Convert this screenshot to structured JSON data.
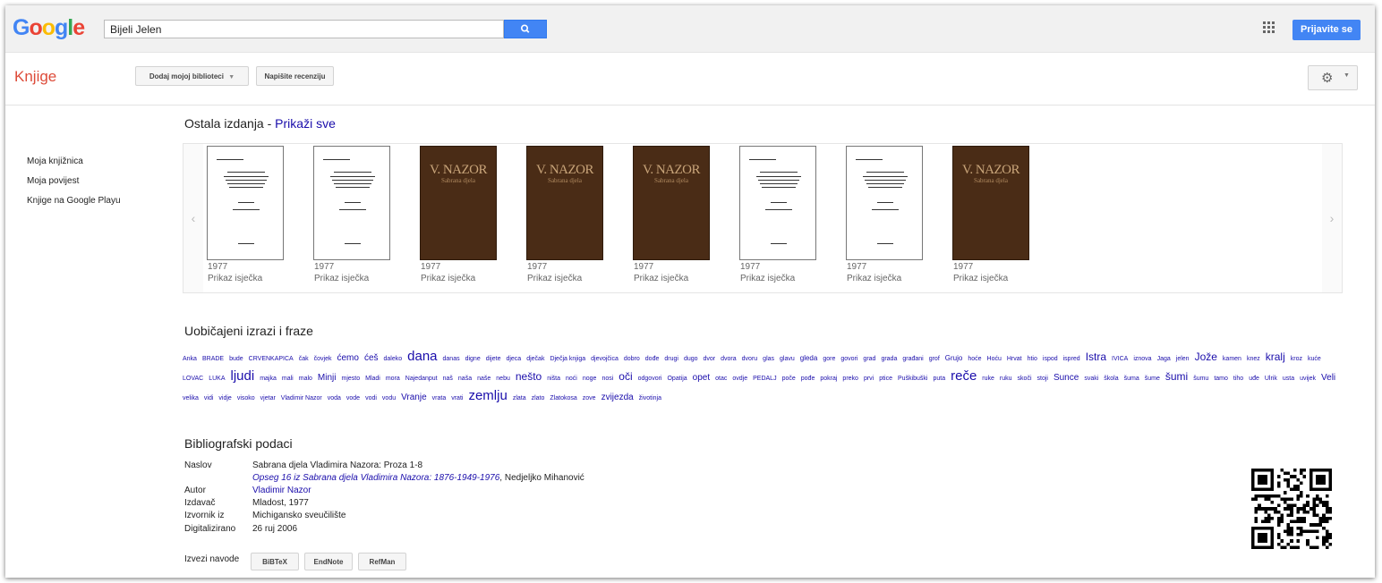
{
  "header": {
    "logo_letters": [
      "G",
      "o",
      "o",
      "g",
      "l",
      "e"
    ],
    "logo_colors": [
      "#4285f4",
      "#ea4335",
      "#fbbc05",
      "#4285f4",
      "#34a853",
      "#ea4335"
    ],
    "search_value": "Bijeli Jelen",
    "signin_label": "Prijavite se"
  },
  "subbar": {
    "section_label": "Knjige",
    "add_library_label": "Dodaj mojoj biblioteci",
    "write_review_label": "Napišite recenziju"
  },
  "sidebar": {
    "items": [
      "Moja knjižnica",
      "Moja povijest",
      "Knjige na Google Playu"
    ]
  },
  "editions": {
    "heading": "Ostala izdanja - ",
    "show_all": "Prikaži sve",
    "books": [
      {
        "year": "1977",
        "snippet": "Prikaz isječka",
        "cover": "light"
      },
      {
        "year": "1977",
        "snippet": "Prikaz isječka",
        "cover": "light"
      },
      {
        "year": "1977",
        "snippet": "Prikaz isječka",
        "cover": "dark",
        "cover_text": "V. NAZOR",
        "cover_sub": "Sabrana djela"
      },
      {
        "year": "1977",
        "snippet": "Prikaz isječka",
        "cover": "dark",
        "cover_text": "V. NAZOR",
        "cover_sub": "Sabrana djela"
      },
      {
        "year": "1977",
        "snippet": "Prikaz isječka",
        "cover": "dark",
        "cover_text": "V. NAZOR",
        "cover_sub": "Sabrana djela"
      },
      {
        "year": "1977",
        "snippet": "Prikaz isječka",
        "cover": "light"
      },
      {
        "year": "1977",
        "snippet": "Prikaz isječka",
        "cover": "light"
      },
      {
        "year": "1977",
        "snippet": "Prikaz isječka",
        "cover": "dark",
        "cover_text": "V. NAZOR",
        "cover_sub": "Sabrana djela"
      }
    ]
  },
  "phrases": {
    "heading": "Uobičajeni izrazi i fraze",
    "words": [
      [
        "Anka",
        1
      ],
      [
        "BRADE",
        1
      ],
      [
        "bude",
        1
      ],
      [
        "CRVENKAPICA",
        1
      ],
      [
        "čak",
        1
      ],
      [
        "čovjek",
        1
      ],
      [
        "ćemo",
        3
      ],
      [
        "ćeš",
        3
      ],
      [
        "daleko",
        1
      ],
      [
        "dana",
        5
      ],
      [
        "danas",
        1
      ],
      [
        "digne",
        1
      ],
      [
        "dijete",
        1
      ],
      [
        "djeca",
        1
      ],
      [
        "dječak",
        1
      ],
      [
        "Dječja knjiga",
        1
      ],
      [
        "djevojčica",
        1
      ],
      [
        "dobro",
        1
      ],
      [
        "dođe",
        1
      ],
      [
        "drugi",
        1
      ],
      [
        "dugo",
        1
      ],
      [
        "dvor",
        1
      ],
      [
        "dvora",
        1
      ],
      [
        "dvoru",
        1
      ],
      [
        "glas",
        1
      ],
      [
        "glavu",
        1
      ],
      [
        "gleda",
        2
      ],
      [
        "gore",
        1
      ],
      [
        "govori",
        1
      ],
      [
        "grad",
        1
      ],
      [
        "grada",
        1
      ],
      [
        "građani",
        1
      ],
      [
        "grof",
        1
      ],
      [
        "Grujo",
        2
      ],
      [
        "hoće",
        1
      ],
      [
        "Hoću",
        1
      ],
      [
        "Hrvat",
        1
      ],
      [
        "htio",
        1
      ],
      [
        "ispod",
        1
      ],
      [
        "ispred",
        1
      ],
      [
        "Istra",
        4
      ],
      [
        "IVICA",
        1
      ],
      [
        "iznova",
        1
      ],
      [
        "Jaga",
        1
      ],
      [
        "jelen",
        1
      ],
      [
        "Jože",
        4
      ],
      [
        "kamen",
        1
      ],
      [
        "knez",
        1
      ],
      [
        "kralj",
        4
      ],
      [
        "kroz",
        1
      ],
      [
        "kuće",
        1
      ],
      [
        "LOVAC",
        1
      ],
      [
        "LUKA",
        1
      ],
      [
        "ljudi",
        5
      ],
      [
        "majka",
        1
      ],
      [
        "mali",
        1
      ],
      [
        "malo",
        1
      ],
      [
        "Minji",
        3
      ],
      [
        "mjesto",
        1
      ],
      [
        "Mladi",
        1
      ],
      [
        "mora",
        1
      ],
      [
        "Najedanput",
        1
      ],
      [
        "naš",
        1
      ],
      [
        "naša",
        1
      ],
      [
        "naše",
        1
      ],
      [
        "nebu",
        1
      ],
      [
        "nešto",
        4
      ],
      [
        "ništa",
        1
      ],
      [
        "noći",
        1
      ],
      [
        "noge",
        1
      ],
      [
        "nosi",
        1
      ],
      [
        "oči",
        4
      ],
      [
        "odgovori",
        1
      ],
      [
        "Opatija",
        1
      ],
      [
        "opet",
        3
      ],
      [
        "otac",
        1
      ],
      [
        "ovdje",
        1
      ],
      [
        "PEDALJ",
        1
      ],
      [
        "poče",
        1
      ],
      [
        "pođe",
        1
      ],
      [
        "pokraj",
        1
      ],
      [
        "preko",
        1
      ],
      [
        "prvi",
        1
      ],
      [
        "ptice",
        1
      ],
      [
        "Puškibuški",
        1
      ],
      [
        "puta",
        1
      ],
      [
        "reče",
        5
      ],
      [
        "ruke",
        1
      ],
      [
        "ruku",
        1
      ],
      [
        "skoči",
        1
      ],
      [
        "stoji",
        1
      ],
      [
        "Sunce",
        3
      ],
      [
        "svaki",
        1
      ],
      [
        "škola",
        1
      ],
      [
        "šuma",
        1
      ],
      [
        "šume",
        1
      ],
      [
        "šumi",
        4
      ],
      [
        "šumu",
        1
      ],
      [
        "tamo",
        1
      ],
      [
        "tiho",
        1
      ],
      [
        "uđe",
        1
      ],
      [
        "Ulrik",
        1
      ],
      [
        "usta",
        1
      ],
      [
        "uvijek",
        1
      ],
      [
        "Veli",
        3
      ],
      [
        "velika",
        1
      ],
      [
        "vidi",
        1
      ],
      [
        "vidje",
        1
      ],
      [
        "visoko",
        1
      ],
      [
        "vjetar",
        1
      ],
      [
        "Vladimir Nazor",
        1
      ],
      [
        "voda",
        1
      ],
      [
        "vode",
        1
      ],
      [
        "vodi",
        1
      ],
      [
        "vodu",
        1
      ],
      [
        "Vranje",
        3
      ],
      [
        "vrata",
        1
      ],
      [
        "vrati",
        1
      ],
      [
        "zemlju",
        5
      ],
      [
        "zlata",
        1
      ],
      [
        "zlato",
        1
      ],
      [
        "Zlatokosa",
        1
      ],
      [
        "zove",
        1
      ],
      [
        "zvijezda",
        3
      ],
      [
        "životinja",
        1
      ]
    ]
  },
  "biblio": {
    "heading": "Bibliografski podaci",
    "title_label": "Naslov",
    "title_value": "Sabrana djela Vladimira Nazora: Proza 1-8",
    "series_link": "Opseg 16 iz Sabrana djela Vladimira Nazora: 1876-1949-1976",
    "series_sep": ", ",
    "series_editor": "Nedjeljko Mihanović",
    "author_label": "Autor",
    "author_value": "Vladimir Nazor",
    "publisher_label": "Izdavač",
    "publisher_value": "Mladost, 1977",
    "source_label": "Izvornik iz",
    "source_value": "Michigansko sveučilište",
    "digitized_label": "Digitalizirano",
    "digitized_value": "26 ruj 2006",
    "export_label": "Izvezi navode",
    "export_buttons": [
      "BiBTeX",
      "EndNote",
      "RefMan"
    ]
  }
}
